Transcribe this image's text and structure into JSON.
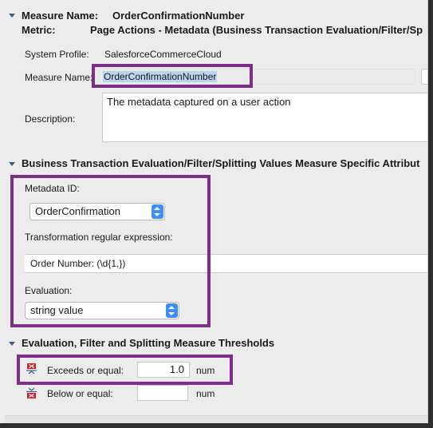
{
  "header": {
    "measure_name_label": "Measure Name:",
    "measure_name_value": "OrderConfirmationNumber",
    "metric_label": "Metric:",
    "metric_value": "Page Actions - Metadata (Business Transaction Evaluation/Filter/Sp"
  },
  "general": {
    "system_profile_label": "System Profile:",
    "system_profile_value": "SalesforceCommerceCloud",
    "measure_name_label": "Measure Name:",
    "measure_name_input": "OrderConfirmationNumber",
    "description_label": "Description:",
    "description_value": "The metadata captured on a user action"
  },
  "section_attributes": {
    "title": "Business Transaction Evaluation/Filter/Splitting Values Measure Specific Attribut",
    "metadata_id_label": "Metadata ID:",
    "metadata_id_value": "OrderConfirmation",
    "regex_label": "Transformation regular expression:",
    "regex_value": "Order Number: (\\d{1,})",
    "evaluation_label": "Evaluation:",
    "evaluation_value": "string value"
  },
  "section_thresholds": {
    "title": "Evaluation, Filter and Splitting Measure Thresholds",
    "exceeds_label": "Exceeds or equal:",
    "exceeds_value": "1.0",
    "exceeds_unit": "num",
    "below_label": "Below or equal:",
    "below_value": "",
    "below_unit": "num"
  },
  "colors": {
    "highlight": "#7b2f86",
    "accent": "#3d8ef8",
    "section_arrow": "#3b5f8e",
    "threshold_icon": "#d0202a"
  },
  "icons": [
    "disclosure-triangle-icon",
    "exceeds-threshold-icon",
    "below-threshold-icon",
    "select-stepper-icon"
  ]
}
